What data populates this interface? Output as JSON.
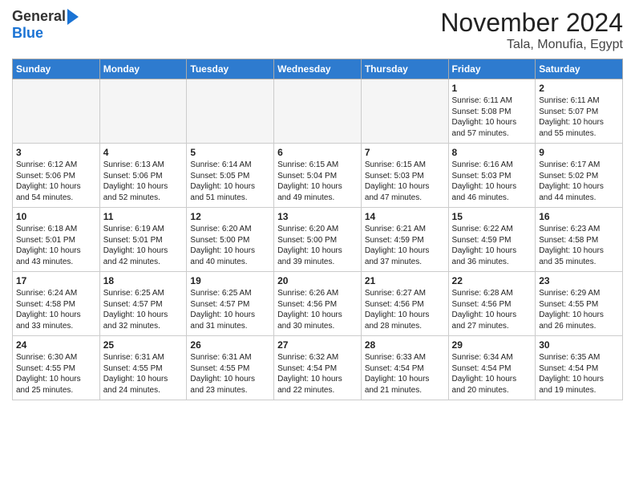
{
  "header": {
    "logo_general": "General",
    "logo_blue": "Blue",
    "month_title": "November 2024",
    "location": "Tala, Monufia, Egypt"
  },
  "days_of_week": [
    "Sunday",
    "Monday",
    "Tuesday",
    "Wednesday",
    "Thursday",
    "Friday",
    "Saturday"
  ],
  "weeks": [
    [
      {
        "day": "",
        "sunrise": "",
        "sunset": "",
        "daylight": "",
        "empty": true
      },
      {
        "day": "",
        "sunrise": "",
        "sunset": "",
        "daylight": "",
        "empty": true
      },
      {
        "day": "",
        "sunrise": "",
        "sunset": "",
        "daylight": "",
        "empty": true
      },
      {
        "day": "",
        "sunrise": "",
        "sunset": "",
        "daylight": "",
        "empty": true
      },
      {
        "day": "",
        "sunrise": "",
        "sunset": "",
        "daylight": "",
        "empty": true
      },
      {
        "day": "1",
        "sunrise": "Sunrise: 6:11 AM",
        "sunset": "Sunset: 5:08 PM",
        "daylight": "Daylight: 10 hours and 57 minutes.",
        "empty": false
      },
      {
        "day": "2",
        "sunrise": "Sunrise: 6:11 AM",
        "sunset": "Sunset: 5:07 PM",
        "daylight": "Daylight: 10 hours and 55 minutes.",
        "empty": false
      }
    ],
    [
      {
        "day": "3",
        "sunrise": "Sunrise: 6:12 AM",
        "sunset": "Sunset: 5:06 PM",
        "daylight": "Daylight: 10 hours and 54 minutes.",
        "empty": false
      },
      {
        "day": "4",
        "sunrise": "Sunrise: 6:13 AM",
        "sunset": "Sunset: 5:06 PM",
        "daylight": "Daylight: 10 hours and 52 minutes.",
        "empty": false
      },
      {
        "day": "5",
        "sunrise": "Sunrise: 6:14 AM",
        "sunset": "Sunset: 5:05 PM",
        "daylight": "Daylight: 10 hours and 51 minutes.",
        "empty": false
      },
      {
        "day": "6",
        "sunrise": "Sunrise: 6:15 AM",
        "sunset": "Sunset: 5:04 PM",
        "daylight": "Daylight: 10 hours and 49 minutes.",
        "empty": false
      },
      {
        "day": "7",
        "sunrise": "Sunrise: 6:15 AM",
        "sunset": "Sunset: 5:03 PM",
        "daylight": "Daylight: 10 hours and 47 minutes.",
        "empty": false
      },
      {
        "day": "8",
        "sunrise": "Sunrise: 6:16 AM",
        "sunset": "Sunset: 5:03 PM",
        "daylight": "Daylight: 10 hours and 46 minutes.",
        "empty": false
      },
      {
        "day": "9",
        "sunrise": "Sunrise: 6:17 AM",
        "sunset": "Sunset: 5:02 PM",
        "daylight": "Daylight: 10 hours and 44 minutes.",
        "empty": false
      }
    ],
    [
      {
        "day": "10",
        "sunrise": "Sunrise: 6:18 AM",
        "sunset": "Sunset: 5:01 PM",
        "daylight": "Daylight: 10 hours and 43 minutes.",
        "empty": false
      },
      {
        "day": "11",
        "sunrise": "Sunrise: 6:19 AM",
        "sunset": "Sunset: 5:01 PM",
        "daylight": "Daylight: 10 hours and 42 minutes.",
        "empty": false
      },
      {
        "day": "12",
        "sunrise": "Sunrise: 6:20 AM",
        "sunset": "Sunset: 5:00 PM",
        "daylight": "Daylight: 10 hours and 40 minutes.",
        "empty": false
      },
      {
        "day": "13",
        "sunrise": "Sunrise: 6:20 AM",
        "sunset": "Sunset: 5:00 PM",
        "daylight": "Daylight: 10 hours and 39 minutes.",
        "empty": false
      },
      {
        "day": "14",
        "sunrise": "Sunrise: 6:21 AM",
        "sunset": "Sunset: 4:59 PM",
        "daylight": "Daylight: 10 hours and 37 minutes.",
        "empty": false
      },
      {
        "day": "15",
        "sunrise": "Sunrise: 6:22 AM",
        "sunset": "Sunset: 4:59 PM",
        "daylight": "Daylight: 10 hours and 36 minutes.",
        "empty": false
      },
      {
        "day": "16",
        "sunrise": "Sunrise: 6:23 AM",
        "sunset": "Sunset: 4:58 PM",
        "daylight": "Daylight: 10 hours and 35 minutes.",
        "empty": false
      }
    ],
    [
      {
        "day": "17",
        "sunrise": "Sunrise: 6:24 AM",
        "sunset": "Sunset: 4:58 PM",
        "daylight": "Daylight: 10 hours and 33 minutes.",
        "empty": false
      },
      {
        "day": "18",
        "sunrise": "Sunrise: 6:25 AM",
        "sunset": "Sunset: 4:57 PM",
        "daylight": "Daylight: 10 hours and 32 minutes.",
        "empty": false
      },
      {
        "day": "19",
        "sunrise": "Sunrise: 6:25 AM",
        "sunset": "Sunset: 4:57 PM",
        "daylight": "Daylight: 10 hours and 31 minutes.",
        "empty": false
      },
      {
        "day": "20",
        "sunrise": "Sunrise: 6:26 AM",
        "sunset": "Sunset: 4:56 PM",
        "daylight": "Daylight: 10 hours and 30 minutes.",
        "empty": false
      },
      {
        "day": "21",
        "sunrise": "Sunrise: 6:27 AM",
        "sunset": "Sunset: 4:56 PM",
        "daylight": "Daylight: 10 hours and 28 minutes.",
        "empty": false
      },
      {
        "day": "22",
        "sunrise": "Sunrise: 6:28 AM",
        "sunset": "Sunset: 4:56 PM",
        "daylight": "Daylight: 10 hours and 27 minutes.",
        "empty": false
      },
      {
        "day": "23",
        "sunrise": "Sunrise: 6:29 AM",
        "sunset": "Sunset: 4:55 PM",
        "daylight": "Daylight: 10 hours and 26 minutes.",
        "empty": false
      }
    ],
    [
      {
        "day": "24",
        "sunrise": "Sunrise: 6:30 AM",
        "sunset": "Sunset: 4:55 PM",
        "daylight": "Daylight: 10 hours and 25 minutes.",
        "empty": false
      },
      {
        "day": "25",
        "sunrise": "Sunrise: 6:31 AM",
        "sunset": "Sunset: 4:55 PM",
        "daylight": "Daylight: 10 hours and 24 minutes.",
        "empty": false
      },
      {
        "day": "26",
        "sunrise": "Sunrise: 6:31 AM",
        "sunset": "Sunset: 4:55 PM",
        "daylight": "Daylight: 10 hours and 23 minutes.",
        "empty": false
      },
      {
        "day": "27",
        "sunrise": "Sunrise: 6:32 AM",
        "sunset": "Sunset: 4:54 PM",
        "daylight": "Daylight: 10 hours and 22 minutes.",
        "empty": false
      },
      {
        "day": "28",
        "sunrise": "Sunrise: 6:33 AM",
        "sunset": "Sunset: 4:54 PM",
        "daylight": "Daylight: 10 hours and 21 minutes.",
        "empty": false
      },
      {
        "day": "29",
        "sunrise": "Sunrise: 6:34 AM",
        "sunset": "Sunset: 4:54 PM",
        "daylight": "Daylight: 10 hours and 20 minutes.",
        "empty": false
      },
      {
        "day": "30",
        "sunrise": "Sunrise: 6:35 AM",
        "sunset": "Sunset: 4:54 PM",
        "daylight": "Daylight: 10 hours and 19 minutes.",
        "empty": false
      }
    ]
  ]
}
